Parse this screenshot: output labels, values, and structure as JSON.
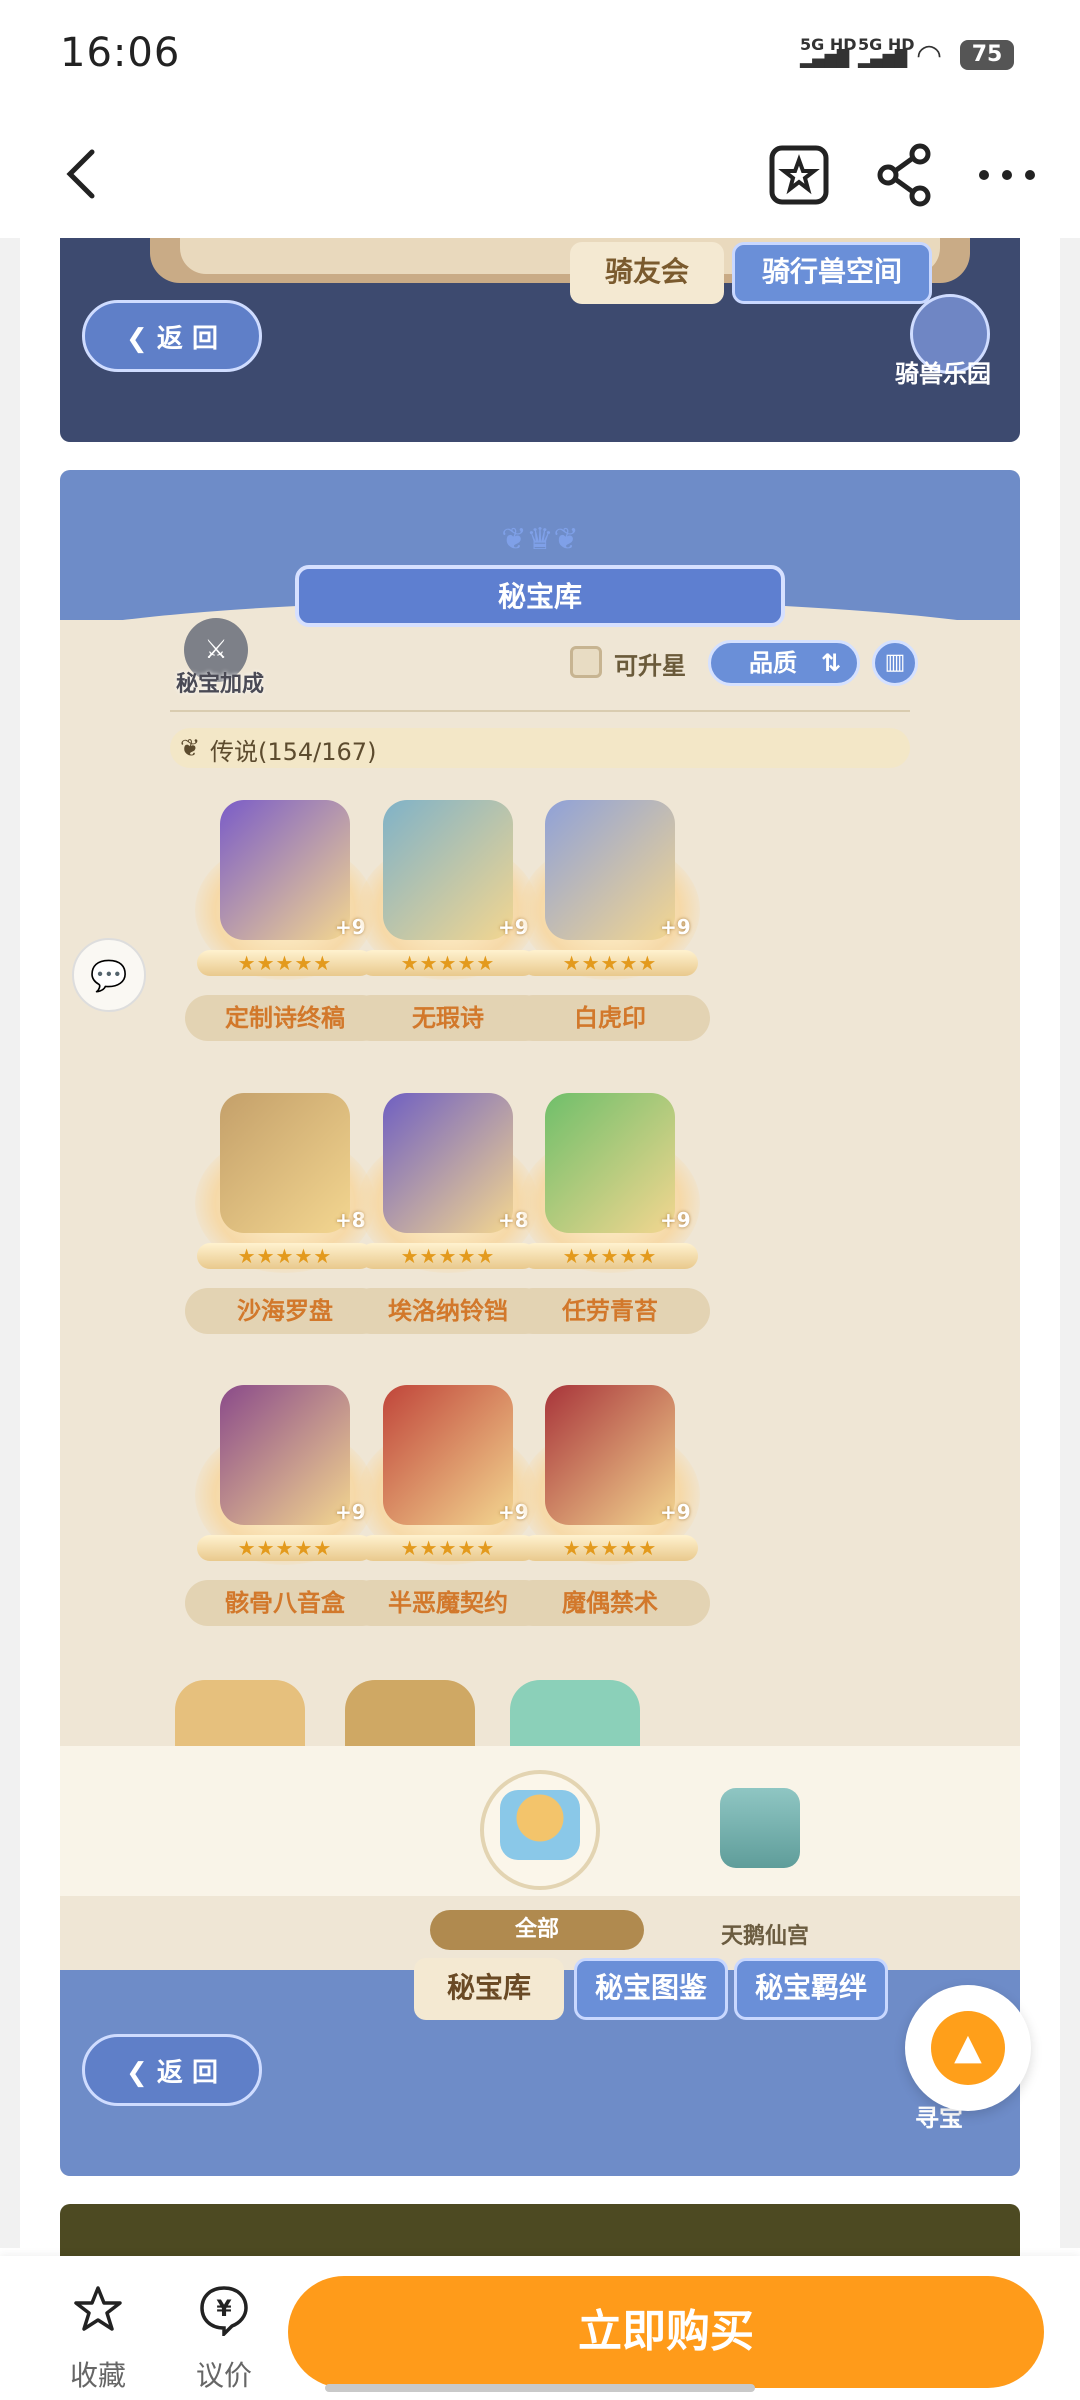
{
  "status": {
    "time": "16:06",
    "signal1": "5G HD",
    "signal2": "5G HD",
    "battery": "75"
  },
  "nav": {
    "back_icon": "chevron-left-icon",
    "fav_icon": "star-bookmark-icon",
    "share_icon": "share-icon",
    "more_icon": "more-icon"
  },
  "banner": {
    "tab_club": "骑友会",
    "tab_space": "骑行兽空间",
    "back_label": "返 回",
    "park_label": "骑兽乐园"
  },
  "panel": {
    "title": "秘宝库",
    "bonus_label": "秘宝加成",
    "upgrade_label": "可升星",
    "quality_label": "品质",
    "legend": "传说(154/167)",
    "items": [
      {
        "name": "定制诗终稿",
        "plus": "+9",
        "color": "#7a5cc8"
      },
      {
        "name": "无瑕诗",
        "plus": "+9",
        "color": "#7fb2c8"
      },
      {
        "name": "白虎印",
        "plus": "+9",
        "color": "#8fa1d8"
      },
      {
        "name": "沙海罗盘",
        "plus": "+8",
        "color": "#c4a06a"
      },
      {
        "name": "埃洛纳铃铛",
        "plus": "+8",
        "color": "#6f5fc2"
      },
      {
        "name": "任劳青苔",
        "plus": "+9",
        "color": "#6fbf6a"
      },
      {
        "name": "骸骨八音盒",
        "plus": "+9",
        "color": "#8a4a8a"
      },
      {
        "name": "半恶魔契约",
        "plus": "+9",
        "color": "#c0453a"
      },
      {
        "name": "魔偶禁术",
        "plus": "+9",
        "color": "#a8343a"
      }
    ],
    "filter_all": "全部",
    "filter_tower": "天鹅仙宫",
    "tabs": [
      "秘宝库",
      "秘宝图鉴",
      "秘宝羁绊"
    ],
    "back_label": "返 回",
    "guide_label": "寻宝"
  },
  "bottom": {
    "fav": "收藏",
    "bargain": "议价",
    "buy": "立即购买"
  }
}
